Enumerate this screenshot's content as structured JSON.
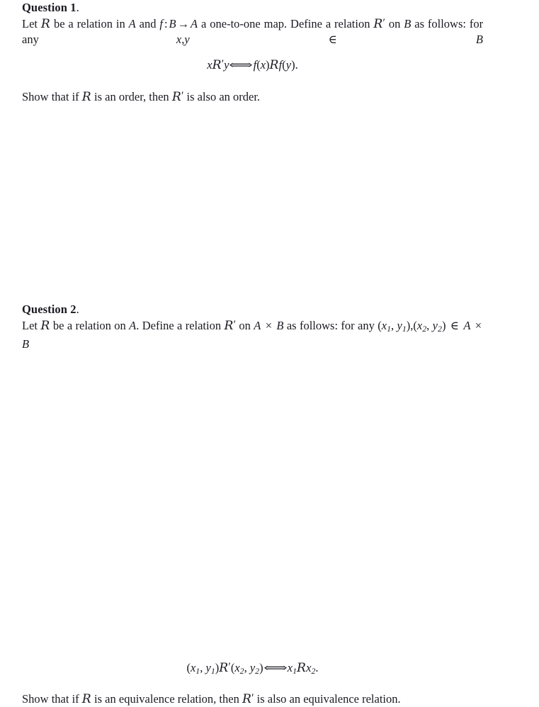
{
  "document": {
    "background_color": "#ffffff",
    "text_color": "#1a1a22",
    "questions": [
      {
        "id": "question-1",
        "heading_label": "Question 1",
        "heading_period": ".",
        "body_text": "Let ℛ be a relation in A and f : B → A a one-to-one map. Define a relation ℛ′ on B as follows: for any x, y ∈ B",
        "body_parts": {
          "p1": "Let",
          "relation_symbol": "R",
          "p2": "be a relation in",
          "set_a": "A",
          "p3": "and",
          "map_f": "f",
          "colon": ":",
          "set_b": "B",
          "arrow": "→",
          "set_a2": "A",
          "p4": "a one-to-one map.  Define a relation",
          "relation_prime": "R",
          "prime": "′",
          "p5": "on",
          "set_b2": "B",
          "p6": "as follows:  for any",
          "var_x": "x",
          "comma": ",",
          "var_y": "y",
          "in_symbol": "∈",
          "set_b3": "B"
        },
        "equation_text": "xℛ′y ⟺ f(x)ℛf(y).",
        "equation_parts": {
          "lhs_x": "x",
          "lhs_rel": "R",
          "lhs_prime": "′",
          "lhs_y": "y",
          "iff": "⟺",
          "rhs_f1": "f",
          "rhs_open1": "(",
          "rhs_x": "x",
          "rhs_close1": ")",
          "rhs_rel": "R",
          "rhs_f2": "f",
          "rhs_open2": "(",
          "rhs_y": "y",
          "rhs_close2": ")",
          "period": "."
        },
        "closing_text": "Show that if ℛ is an order, then ℛ′ is also an order.",
        "closing_parts": {
          "c1": "Show that if",
          "rel": "R",
          "c2": "is an order, then",
          "rel_prime": "R",
          "prime": "′",
          "c3": "is also an order."
        }
      },
      {
        "id": "question-2",
        "heading_label": "Question 2",
        "heading_period": ".",
        "body_text": "Let ℛ be a relation on A.  Define a relation ℛ′ on A × B as follows:  for any (x₁, y₁), (x₂, y₂) ∈ A × B",
        "body_parts": {
          "p1": "Let",
          "relation_symbol": "R",
          "p2": "be a relation on",
          "set_a": "A",
          "p3": ".   Define a relation",
          "relation_prime": "R",
          "prime": "′",
          "p4": "on",
          "set_a2": "A",
          "times": "×",
          "set_b": "B",
          "p5": "as follows:   for any",
          "pair1_open": "(",
          "pair1_x": "x",
          "pair1_xsub": "1",
          "pair1_comma": ",",
          "pair1_y": "y",
          "pair1_ysub": "1",
          "pair1_close": ")",
          "pair_comma": ",",
          "pair2_open": "(",
          "pair2_x": "x",
          "pair2_xsub": "2",
          "pair2_comma": ",",
          "pair2_y": "y",
          "pair2_ysub": "2",
          "pair2_close": ")",
          "in_symbol": "∈",
          "set_a3": "A",
          "times2": "×",
          "set_b2": "B"
        },
        "equation_text": "(x₁, y₁)ℛ′(x₂, y₂) ⟺ x₁ℛx₂.",
        "equation_parts": {
          "open1": "(",
          "x1": "x",
          "x1sub": "1",
          "comma1": ",",
          "y1": "y",
          "y1sub": "1",
          "close1": ")",
          "rel": "R",
          "prime": "′",
          "open2": "(",
          "x2": "x",
          "x2sub": "2",
          "comma2": ",",
          "y2": "y",
          "y2sub": "2",
          "close2": ")",
          "iff": "⟺",
          "rhs_x1": "x",
          "rhs_x1sub": "1",
          "rhs_rel": "R",
          "rhs_x2": "x",
          "rhs_x2sub": "2",
          "period": "."
        },
        "closing_text": "Show that if ℛ is an equivalence relation, then ℛ′ is also an equivalence relation.",
        "closing_parts": {
          "c1": "Show that if",
          "rel": "R",
          "c2": "is an equivalence relation, then",
          "rel_prime": "R",
          "prime": "′",
          "c3": "is also an equivalence relation."
        }
      }
    ]
  }
}
